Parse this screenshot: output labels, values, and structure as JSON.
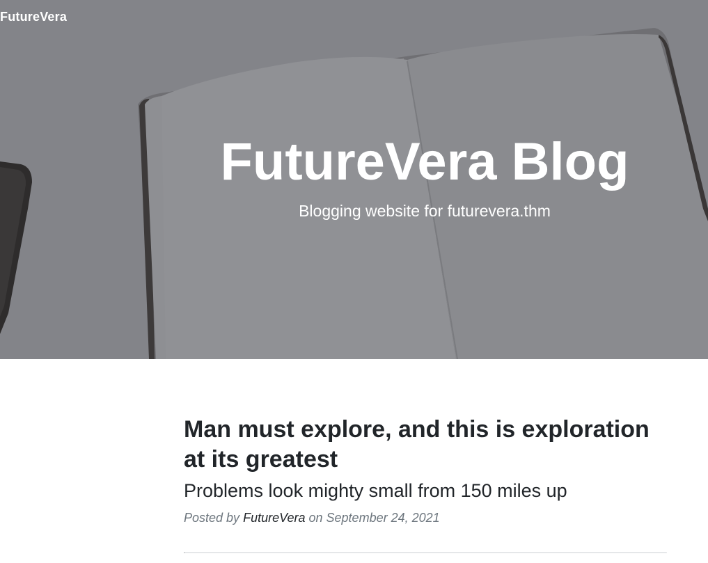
{
  "navbar": {
    "brand": "FutureVera"
  },
  "hero": {
    "title": "FutureVera Blog",
    "subtitle": "Blogging website for futurevera.thm"
  },
  "posts": [
    {
      "title": "Man must explore, and this is exploration at its greatest",
      "subtitle": "Problems look mighty small from 150 miles up",
      "meta_prefix": "Posted by",
      "author": "FutureVera",
      "meta_middle": "on",
      "date": "September 24, 2021"
    }
  ],
  "colors": {
    "text_dark": "#212529",
    "text_muted": "#6c757d",
    "hero_overlay": "#808186",
    "divider": "#dee2e6"
  }
}
